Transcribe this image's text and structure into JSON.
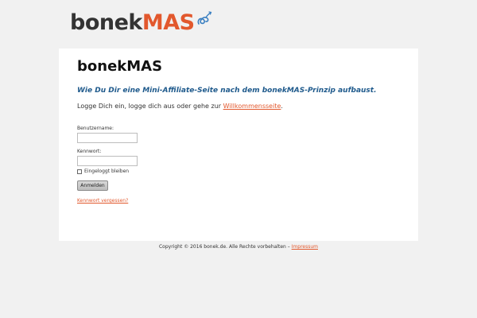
{
  "logo": {
    "part_dark": "bonek",
    "part_accent": "MAS",
    "icon": "pretzel-icon"
  },
  "card": {
    "title": "bonekMAS",
    "tagline": "Wie Du Dir eine Mini-Affiliate-Seite nach dem bonekMAS-Prinzip aufbaust.",
    "intro_text": "Logge Dich ein, logge dich aus oder gehe zur ",
    "intro_link": "Willkommensseite",
    "intro_end": ".",
    "username_label": "Benutzername:",
    "username_value": "",
    "password_label": "Kennwort:",
    "password_value": "",
    "remember_label": "Eingeloggt bleiben",
    "remember_checked": false,
    "submit_label": "Anmelden",
    "forgot_link": "Kennwort vergessen?"
  },
  "footer": {
    "copyright": "Copyright © 2016 bonek.de. Alle Rechte vorbehalten – ",
    "imprint_link": "Impressum"
  },
  "colors": {
    "accent": "#e2582d",
    "tagline": "#1f5a8c",
    "background": "#f1f1f1"
  }
}
